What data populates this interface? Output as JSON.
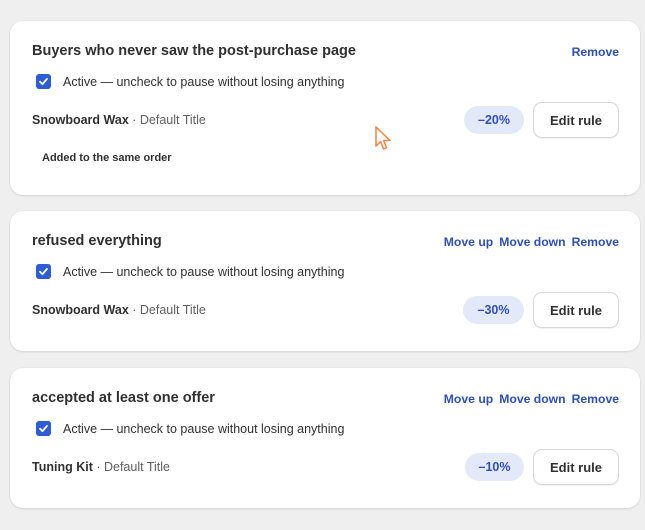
{
  "rules": [
    {
      "title": "Buyers who never saw the post-purchase page",
      "actions": [
        "Remove"
      ],
      "active_label": "Active — uncheck to pause without losing anything",
      "active_checked": true,
      "product_name": "Snowboard Wax",
      "separator": " · ",
      "variant": "Default Title",
      "discount": "–20%",
      "edit_label": "Edit rule",
      "note": "Added to the same order"
    },
    {
      "title": "refused everything",
      "actions": [
        "Move up",
        "Move down",
        "Remove"
      ],
      "active_label": "Active — uncheck to pause without losing anything",
      "active_checked": true,
      "product_name": "Snowboard Wax",
      "separator": " · ",
      "variant": "Default Title",
      "discount": "–30%",
      "edit_label": "Edit rule"
    },
    {
      "title": "accepted at least one offer",
      "actions": [
        "Move up",
        "Move down",
        "Remove"
      ],
      "active_label": "Active — uncheck to pause without losing anything",
      "active_checked": true,
      "product_name": "Tuning Kit",
      "separator": " · ",
      "variant": "Default Title",
      "discount": "–10%",
      "edit_label": "Edit rule"
    }
  ],
  "colors": {
    "accent": "#2c4fba",
    "checkbox": "#2c5cd6",
    "discount_bg": "#e3e9f8"
  },
  "icons": {
    "checkbox": "checkmark-icon",
    "cursor": "mouse-pointer-icon"
  }
}
